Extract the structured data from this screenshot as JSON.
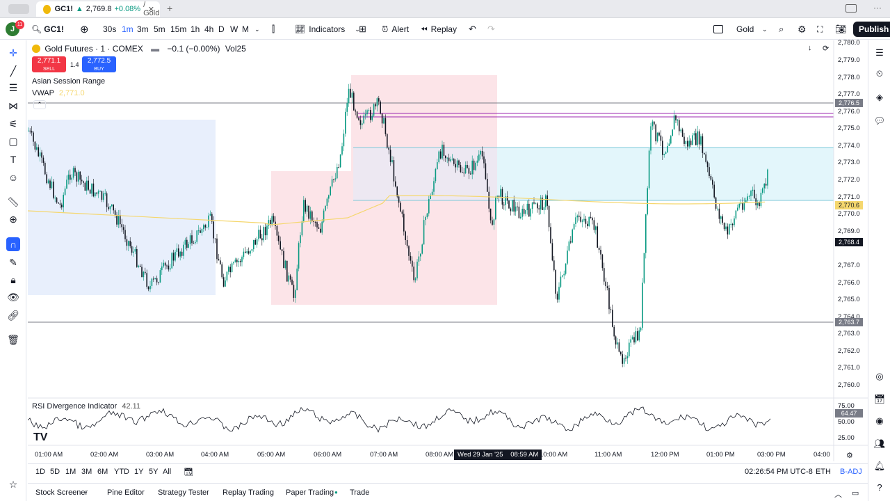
{
  "browser_tab": {
    "symbol": "GC1!",
    "price": "2,769.8",
    "change": "+0.08%",
    "suffix": "/ Gold"
  },
  "toolbar": {
    "notifications": "11",
    "avatar_letter": "J",
    "symbol": "GC1!",
    "intervals": [
      "30s",
      "1m",
      "3m",
      "5m",
      "15m",
      "1h",
      "4h",
      "D",
      "W",
      "M"
    ],
    "active_interval": "1m",
    "indicators_label": "Indicators",
    "alert_label": "Alert",
    "replay_label": "Replay",
    "layout_name": "Gold",
    "publish_label": "Publish"
  },
  "legend": {
    "title": "Gold Futures · 1 · COMEX",
    "change": "−0.1 (−0.00%)",
    "volume": "Vol25",
    "sell_price": "2,771.1",
    "sell_label": "SELL",
    "spread": "1.4",
    "buy_price": "2,772.5",
    "buy_label": "BUY",
    "indicator_1": "Asian Session Range",
    "indicator_2": "VWAP",
    "vwap_value": "2,771.0"
  },
  "rsi": {
    "label": "RSI Divergence Indicator",
    "value": "42.11",
    "current_tag": "64.47",
    "levels": [
      "75.00",
      "50.00",
      "25.00"
    ]
  },
  "price_axis": {
    "labels": [
      "2,780.0",
      "2,779.0",
      "2,778.0",
      "2,777.0",
      "2,776.0",
      "2,775.0",
      "2,774.0",
      "2,773.0",
      "2,772.0",
      "2,771.0",
      "2,770.0",
      "2,769.0",
      "2,767.0",
      "2,766.0",
      "2,765.0",
      "2,764.0",
      "2,763.0",
      "2,762.0",
      "2,761.0",
      "2,760.0"
    ],
    "tag_upper_line": "2,776.5",
    "tag_vwap": "2,770.6",
    "tag_current": "2,768.4",
    "tag_lower_line": "2,763.7"
  },
  "time_axis": {
    "labels": [
      "01:00 AM",
      "02:00 AM",
      "03:00 AM",
      "04:00 AM",
      "05:00 AM",
      "06:00 AM",
      "07:00 AM",
      "08:00 AM",
      "10:00 AM",
      "11:00 AM",
      "12:00 PM",
      "01:00 PM",
      "03:00 PM",
      "04:00"
    ],
    "crosshair_date": "Wed 29 Jan '25",
    "crosshair_time": "08:59 AM"
  },
  "range_bar": {
    "ranges": [
      "1D",
      "5D",
      "1M",
      "3M",
      "6M",
      "YTD",
      "1Y",
      "5Y",
      "All"
    ],
    "clock": "02:26:54 PM UTC-8",
    "session": "ETH",
    "adjust": "B-ADJ"
  },
  "panels": [
    "Stock Screener",
    "Pine Editor",
    "Strategy Tester",
    "Replay Trading",
    "Paper Trading",
    "Trade"
  ],
  "colors": {
    "up": "#089981",
    "down": "#131722",
    "sell": "#f23645",
    "buy": "#2962ff",
    "vwap": "#f5d76e",
    "asian_box": "#e8effc",
    "pink_box": "#fce4e8",
    "cyan_box": "#e3f6fb"
  }
}
